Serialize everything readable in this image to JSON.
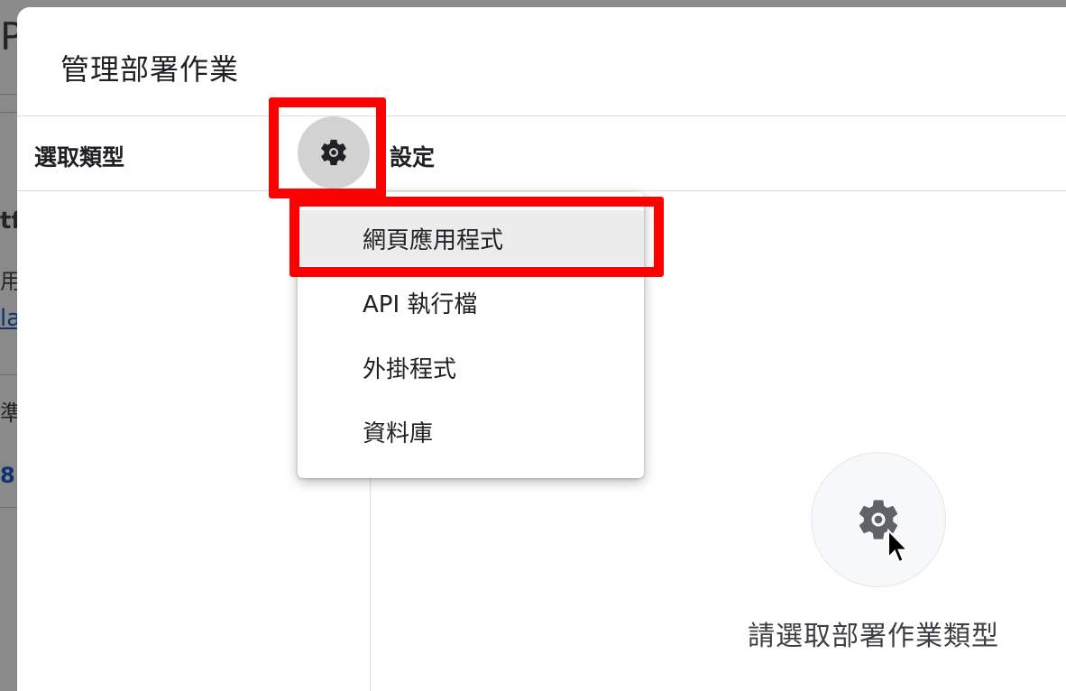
{
  "background": {
    "fragments": [
      "P",
      "tf",
      "用",
      "la",
      "準",
      "8"
    ]
  },
  "dialog": {
    "title": "管理部署作業",
    "left_column_header": "選取類型",
    "right_column_header": "設定"
  },
  "type_menu": {
    "items": [
      {
        "label": "網頁應用程式",
        "selected": true
      },
      {
        "label": "API 執行檔",
        "selected": false
      },
      {
        "label": "外掛程式",
        "selected": false
      },
      {
        "label": "資料庫",
        "selected": false
      }
    ]
  },
  "empty_state": {
    "icon": "gear-icon",
    "message": "請選取部署作業類型"
  },
  "colors": {
    "highlight": "#ff0000",
    "selected_item_bg": "#ececec",
    "gear_button_bg": "#d2d2d2"
  }
}
